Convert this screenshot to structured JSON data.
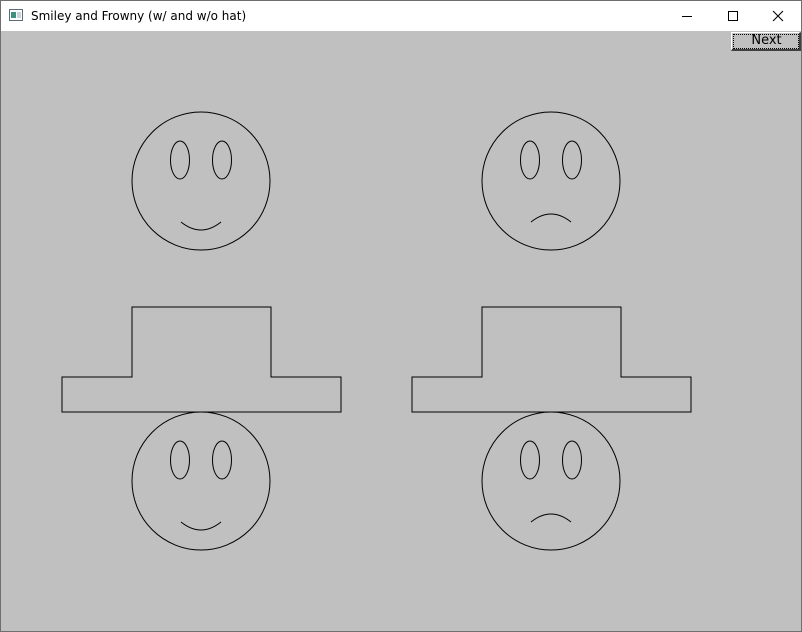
{
  "window": {
    "title": "Smiley and Frowny (w/ and w/o hat)"
  },
  "toolbar": {
    "next_label": "Next"
  },
  "colors": {
    "canvas_background": "#c0c0c0",
    "stroke": "#000000",
    "titlebar": "#ffffff"
  },
  "icons": {
    "app": "app-icon",
    "minimize": "minimize-icon",
    "maximize": "maximize-icon",
    "close": "close-icon"
  },
  "faces": [
    {
      "mood": "smile",
      "hat": false
    },
    {
      "mood": "frown",
      "hat": false
    },
    {
      "mood": "smile",
      "hat": true
    },
    {
      "mood": "frown",
      "hat": true
    }
  ]
}
